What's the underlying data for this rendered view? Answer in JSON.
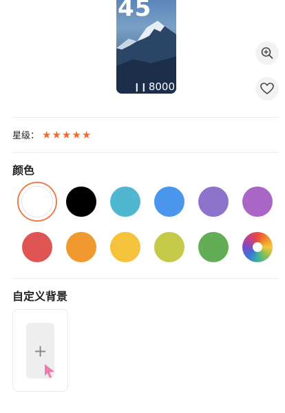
{
  "preview": {
    "time": "45",
    "steps": "8000",
    "steps_icon": "footprints-icon"
  },
  "actions": {
    "zoom_icon": "zoom-in-icon",
    "favorite_icon": "heart-icon"
  },
  "rating": {
    "label": "星级：",
    "stars": 5
  },
  "colors": {
    "title": "颜色",
    "selected": "#ffffff",
    "swatches": [
      "#ffffff",
      "#000000",
      "#4fb8d0",
      "#4a96ec",
      "#8e73cc",
      "#aa66c6",
      "#df5553",
      "#f0992f",
      "#f5c23b",
      "#c5c94a",
      "#62ad55",
      "multicolor"
    ]
  },
  "custom_background": {
    "title": "自定义背景",
    "add_symbol": "+"
  }
}
